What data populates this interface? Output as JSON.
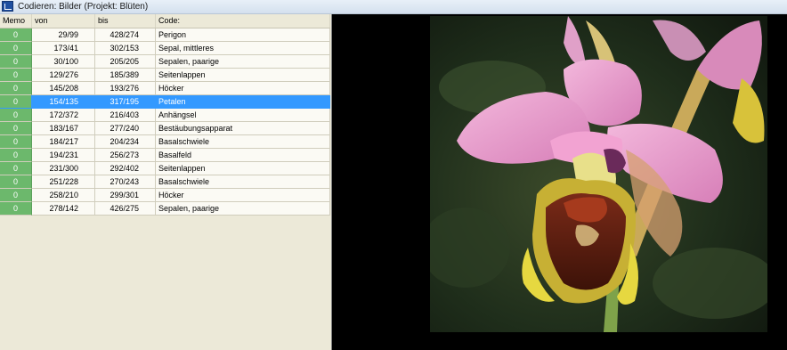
{
  "window": {
    "title": "Codieren: Bilder (Projekt: Blüten)"
  },
  "table": {
    "headers": {
      "memo": "Memo",
      "von": "von",
      "bis": "bis",
      "code": "Code:"
    },
    "rows": [
      {
        "memo": "0",
        "von": "29/99",
        "bis": "428/274",
        "code": "Perigon"
      },
      {
        "memo": "0",
        "von": "173/41",
        "bis": "302/153",
        "code": "Sepal, mittleres"
      },
      {
        "memo": "0",
        "von": "30/100",
        "bis": "205/205",
        "code": "Sepalen, paarige"
      },
      {
        "memo": "0",
        "von": "129/276",
        "bis": "185/389",
        "code": "Seitenlappen"
      },
      {
        "memo": "0",
        "von": "145/208",
        "bis": "193/276",
        "code": "Höcker"
      },
      {
        "memo": "0",
        "von": "154/135",
        "bis": "317/195",
        "code": "Petalen"
      },
      {
        "memo": "0",
        "von": "172/372",
        "bis": "216/403",
        "code": "Anhängsel"
      },
      {
        "memo": "0",
        "von": "183/167",
        "bis": "277/240",
        "code": "Bestäubungsapparat"
      },
      {
        "memo": "0",
        "von": "184/217",
        "bis": "204/234",
        "code": "Basalschwiele"
      },
      {
        "memo": "0",
        "von": "194/231",
        "bis": "256/273",
        "code": "Basalfeld"
      },
      {
        "memo": "0",
        "von": "231/300",
        "bis": "292/402",
        "code": "Seitenlappen"
      },
      {
        "memo": "0",
        "von": "251/228",
        "bis": "270/243",
        "code": "Basalschwiele"
      },
      {
        "memo": "0",
        "von": "258/210",
        "bis": "299/301",
        "code": "Höcker"
      },
      {
        "memo": "0",
        "von": "278/142",
        "bis": "426/275",
        "code": "Sepalen, paarige"
      }
    ],
    "selected_row": 5
  },
  "colors": {
    "selection": "#3399ff",
    "memo_cell": "#6cb86c",
    "viewer_background": "#000000"
  }
}
